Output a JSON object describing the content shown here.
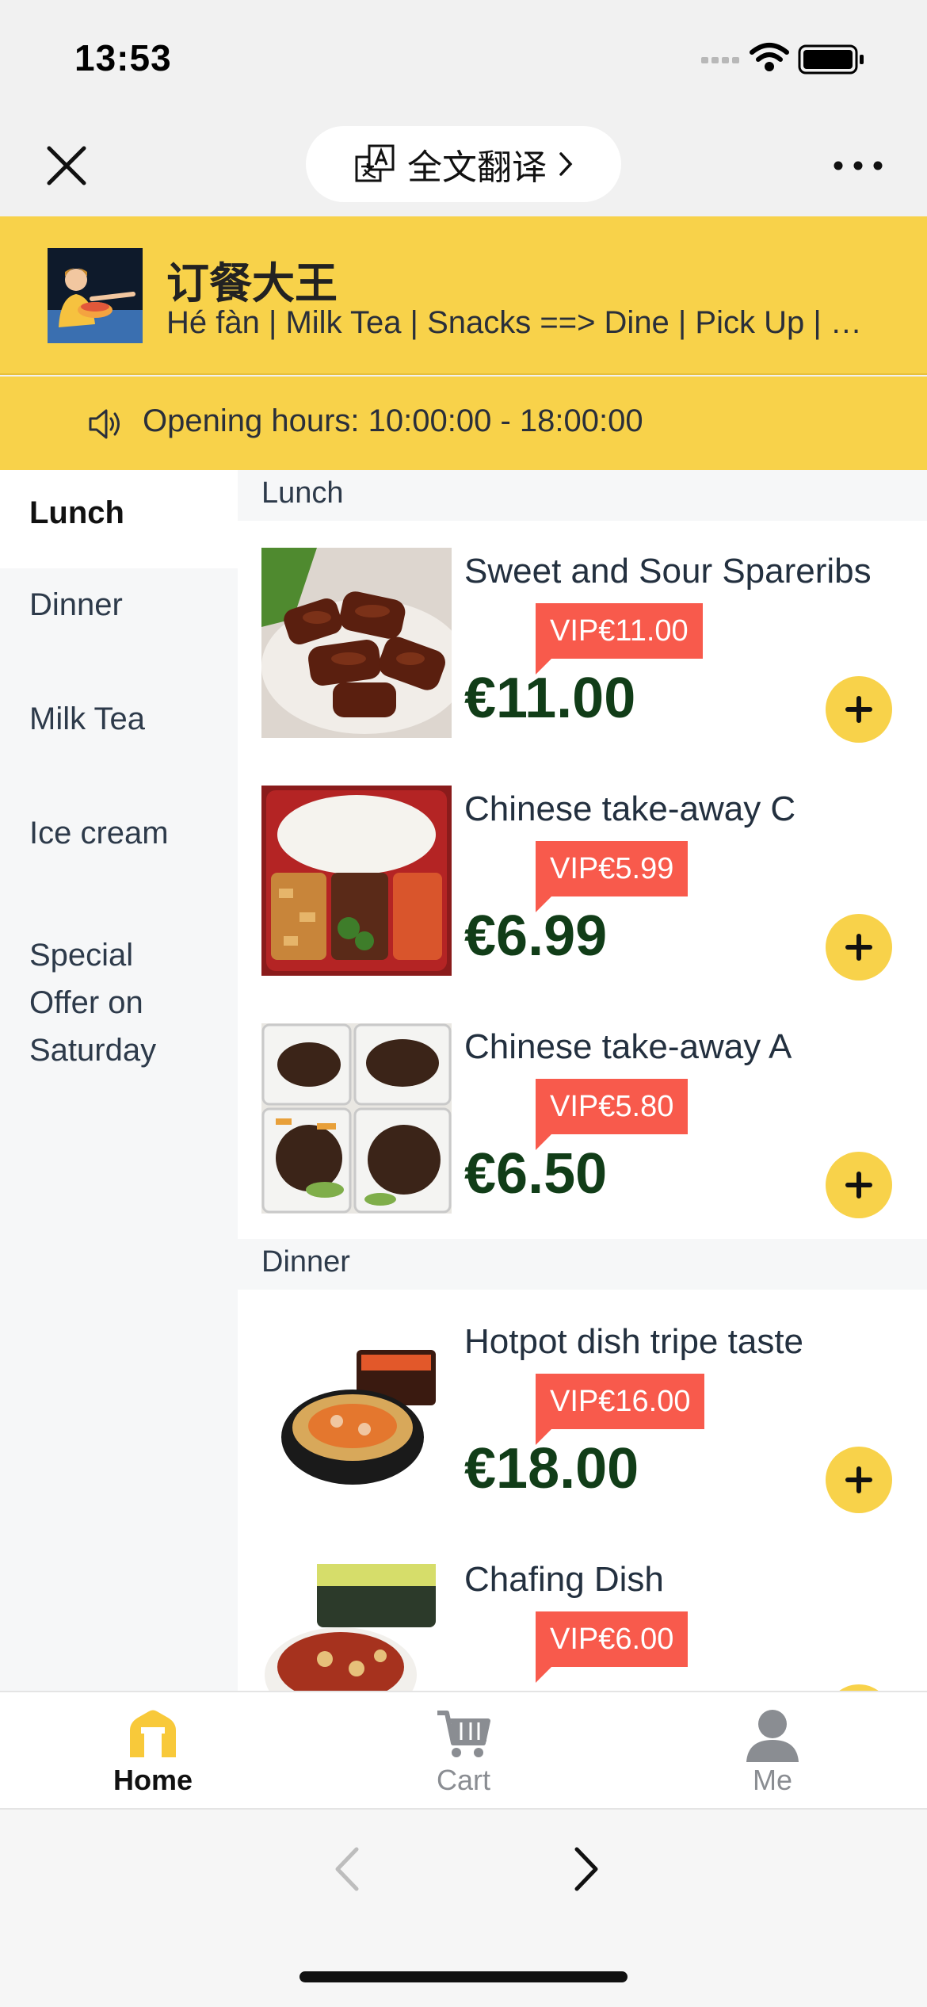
{
  "status": {
    "time": "13:53"
  },
  "nav": {
    "translate_label": "全文翻译"
  },
  "store": {
    "name": "订餐大王",
    "description": "Hé fàn | Milk Tea | Snacks ==> Dine | Pick Up | Delivery",
    "hours": "Opening hours: 10:00:00 - 18:00:00"
  },
  "categories": [
    {
      "label": "Lunch",
      "active": true
    },
    {
      "label": "Dinner"
    },
    {
      "label": "Milk Tea"
    },
    {
      "label": "Ice cream"
    },
    {
      "label": "Special Offer on Saturday"
    }
  ],
  "sections": [
    {
      "title": "Lunch",
      "items": [
        {
          "name": "Sweet and Sour Spareribs",
          "vip": "VIP€11.00",
          "price": "€11.00"
        },
        {
          "name": "Chinese take-away C",
          "vip": "VIP€5.99",
          "price": "€6.99"
        },
        {
          "name": "Chinese take-away A",
          "vip": "VIP€5.80",
          "price": "€6.50"
        }
      ]
    },
    {
      "title": "Dinner",
      "items": [
        {
          "name": "Hotpot dish tripe taste",
          "vip": "VIP€16.00",
          "price": "€18.00"
        },
        {
          "name": "Chafing Dish",
          "vip": "VIP€6.00",
          "price": ""
        }
      ]
    }
  ],
  "tabs": [
    {
      "label": "Home",
      "icon": "home-icon",
      "active": true
    },
    {
      "label": "Cart",
      "icon": "cart-icon"
    },
    {
      "label": "Me",
      "icon": "person-icon"
    }
  ],
  "colors": {
    "accent": "#f8d24a",
    "vip": "#f85a4c",
    "price": "#113d18"
  }
}
